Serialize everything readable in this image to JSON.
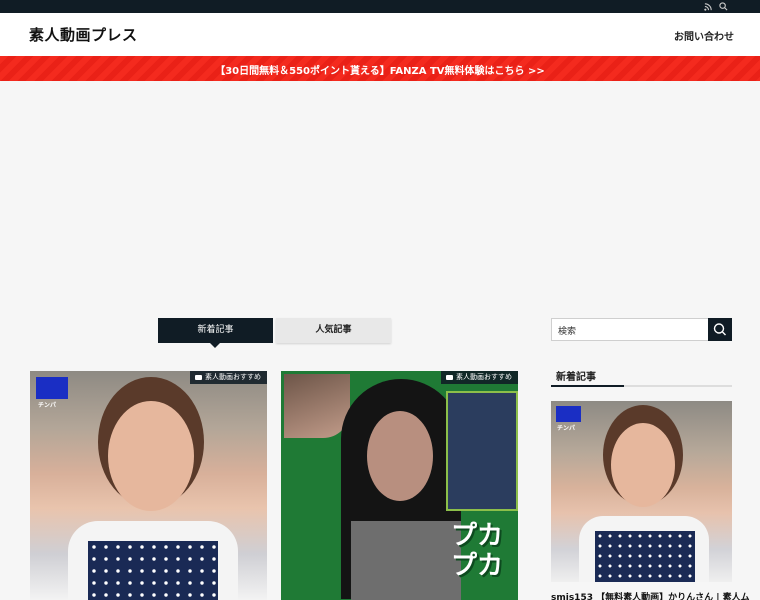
{
  "topbar": {
    "rss_icon": "rss-icon",
    "search_icon": "search-icon"
  },
  "header": {
    "site_title": "素人動画プレス",
    "contact_link": "お問い合わせ"
  },
  "banner": {
    "text": "【30日間無料＆550ポイント貰える】FANZA TV無料体験はこちら >>"
  },
  "tabs": [
    {
      "label": "新着記事",
      "active": true
    },
    {
      "label": "人気記事",
      "active": false
    }
  ],
  "cards": [
    {
      "category": "素人動画おすすめ",
      "thumb_logo": "チンパ"
    },
    {
      "category": "素人動画おすすめ",
      "thumb_text": "プカプカ"
    }
  ],
  "sidebar": {
    "search_placeholder": "検索",
    "heading": "新着記事",
    "latest": {
      "logo": "チンパ",
      "title": "smjs153 【無料素人動画】かりんさん | 素人ム"
    }
  },
  "colors": {
    "dark": "#101c25",
    "banner_red": "#f42a1e",
    "card_green": "#1f7a35"
  }
}
